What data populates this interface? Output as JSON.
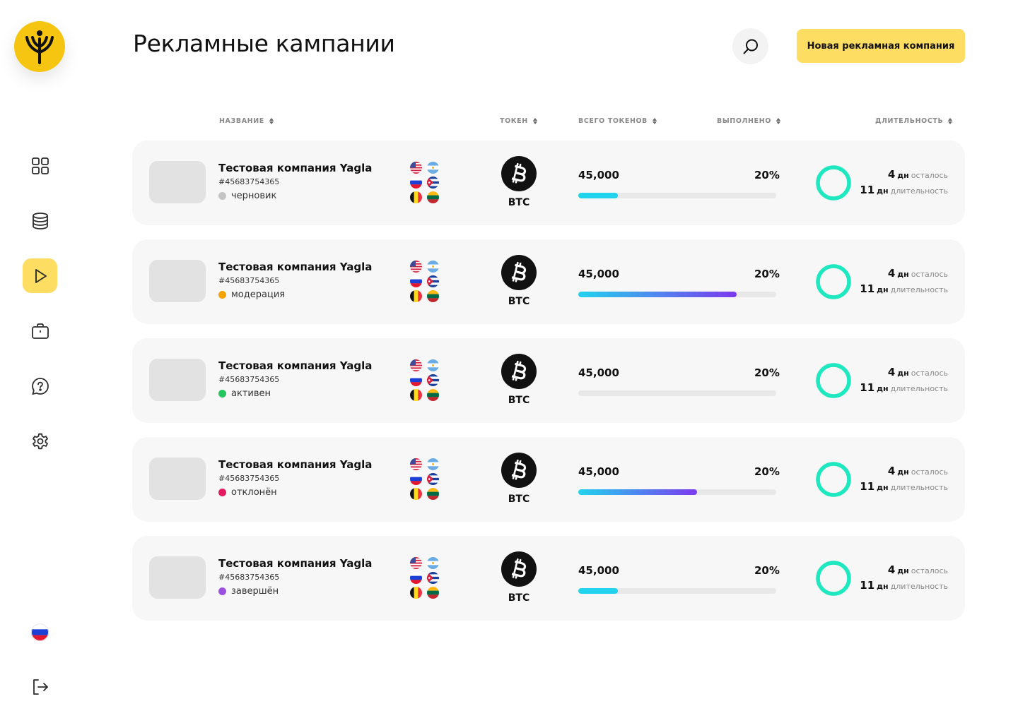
{
  "header": {
    "title": "Рекламные кампании",
    "new_button": "Новая рекламная компания"
  },
  "sidebar": {
    "logo_icon": "yagla-logo-icon",
    "items": [
      {
        "icon": "dashboard-icon",
        "active": false
      },
      {
        "icon": "database-icon",
        "active": false
      },
      {
        "icon": "play-icon",
        "active": true
      },
      {
        "icon": "briefcase-icon",
        "active": false
      },
      {
        "icon": "help-chat-icon",
        "active": false
      },
      {
        "icon": "settings-gear-icon",
        "active": false
      }
    ],
    "language_flag": "russia-flag-icon",
    "logout_icon": "logout-icon"
  },
  "columns": {
    "name": "НАЗВАНИЕ",
    "token": "ТОКЕН",
    "total": "ВСЕГО ТОКЕНОВ",
    "done": "ВЫПОЛНЕНО",
    "duration": "ДЛИТЕЛЬНОСТЬ"
  },
  "colors": {
    "accent_yellow": "#fedd63",
    "logo_yellow": "#f5c511",
    "ring_teal": "#1ee8c0",
    "bar_start": "#22d3ee",
    "bar_end": "#7c3aed",
    "status_draft": "#c4c4c4",
    "status_moderation": "#f5a300",
    "status_active": "#22c55e",
    "status_rejected": "#e5195e",
    "status_finished": "#9b51e0"
  },
  "campaigns": [
    {
      "name": "Тестовая компания Yagla",
      "id": "#45683754365",
      "status": "черновик",
      "status_color": "#c4c4c4",
      "flags": [
        "usa-flag-icon",
        "argentina-flag-icon",
        "russia-flag-icon",
        "cuba-flag-icon",
        "belgium-flag-icon",
        "lithuania-flag-icon"
      ],
      "token": "BTC",
      "token_icon": "bitcoin-icon",
      "total": "45,000",
      "done": "20%",
      "progress": 0.2,
      "days_left": "4",
      "days_left_unit": "дн",
      "days_left_label": "осталось",
      "days_total": "11",
      "days_total_unit": "дн",
      "days_total_label": "длительность"
    },
    {
      "name": "Тестовая компания Yagla",
      "id": "#45683754365",
      "status": "модерация",
      "status_color": "#f5a300",
      "flags": [
        "usa-flag-icon",
        "argentina-flag-icon",
        "russia-flag-icon",
        "cuba-flag-icon",
        "belgium-flag-icon",
        "lithuania-flag-icon"
      ],
      "token": "BTC",
      "token_icon": "bitcoin-icon",
      "total": "45,000",
      "done": "20%",
      "progress": 0.8,
      "days_left": "4",
      "days_left_unit": "дн",
      "days_left_label": "осталось",
      "days_total": "11",
      "days_total_unit": "дн",
      "days_total_label": "длительность"
    },
    {
      "name": "Тестовая компания Yagla",
      "id": "#45683754365",
      "status": "активен",
      "status_color": "#22c55e",
      "flags": [
        "usa-flag-icon",
        "argentina-flag-icon",
        "russia-flag-icon",
        "cuba-flag-icon",
        "belgium-flag-icon",
        "lithuania-flag-icon"
      ],
      "token": "BTC",
      "token_icon": "bitcoin-icon",
      "total": "45,000",
      "done": "20%",
      "progress": 0,
      "days_left": "4",
      "days_left_unit": "дн",
      "days_left_label": "осталось",
      "days_total": "11",
      "days_total_unit": "дн",
      "days_total_label": "длительность"
    },
    {
      "name": "Тестовая компания Yagla",
      "id": "#45683754365",
      "status": "отклонён",
      "status_color": "#e5195e",
      "flags": [
        "usa-flag-icon",
        "argentina-flag-icon",
        "russia-flag-icon",
        "cuba-flag-icon",
        "belgium-flag-icon",
        "lithuania-flag-icon"
      ],
      "token": "BTC",
      "token_icon": "bitcoin-icon",
      "total": "45,000",
      "done": "20%",
      "progress": 0.6,
      "days_left": "4",
      "days_left_unit": "дн",
      "days_left_label": "осталось",
      "days_total": "11",
      "days_total_unit": "дн",
      "days_total_label": "длительность"
    },
    {
      "name": "Тестовая компания Yagla",
      "id": "#45683754365",
      "status": "завершён",
      "status_color": "#9b51e0",
      "flags": [
        "usa-flag-icon",
        "argentina-flag-icon",
        "russia-flag-icon",
        "cuba-flag-icon",
        "belgium-flag-icon",
        "lithuania-flag-icon"
      ],
      "token": "BTC",
      "token_icon": "bitcoin-icon",
      "total": "45,000",
      "done": "20%",
      "progress": 0.2,
      "days_left": "4",
      "days_left_unit": "дн",
      "days_left_label": "осталось",
      "days_total": "11",
      "days_total_unit": "дн",
      "days_total_label": "длительность"
    }
  ]
}
